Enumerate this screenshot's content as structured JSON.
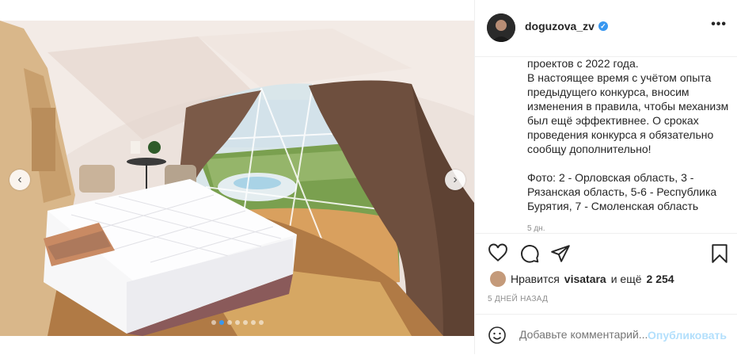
{
  "post": {
    "username": "doguzova_zv",
    "caption": "проектов с 2022 года.\nВ настоящее время с учётом опыта предыдущего конкурса, вносим изменения в правила, чтобы механизм был ещё эффективнее. О сроках проведения конкурса я обязательно сообщу дополнительно!\n\nФото: 2 - Орловская область, 3 - Рязанская область, 5-6 - Республика Бурятия, 7 - Смоленская область",
    "caption_time": "5 дн.",
    "likes_prefix": "Нравится",
    "likes_user": "visatara",
    "likes_and": "и ещё",
    "likes_count": "2 254",
    "date": "5 ДНЕЙ НАЗАД",
    "comment_placeholder": "Добавьте комментарий...",
    "publish_label": "Опубликовать",
    "more_icon": "•••",
    "carousel": {
      "total": 7,
      "active": 2
    }
  },
  "icons": [
    "chevron-left-icon",
    "chevron-right-icon",
    "verified-icon",
    "more-icon",
    "heart-icon",
    "comment-icon",
    "share-icon",
    "bookmark-icon",
    "emoji-icon"
  ],
  "colors": {
    "accent": "#3897f0",
    "publish_disabled": "#b2dffc",
    "muted": "#8e8e8e"
  }
}
